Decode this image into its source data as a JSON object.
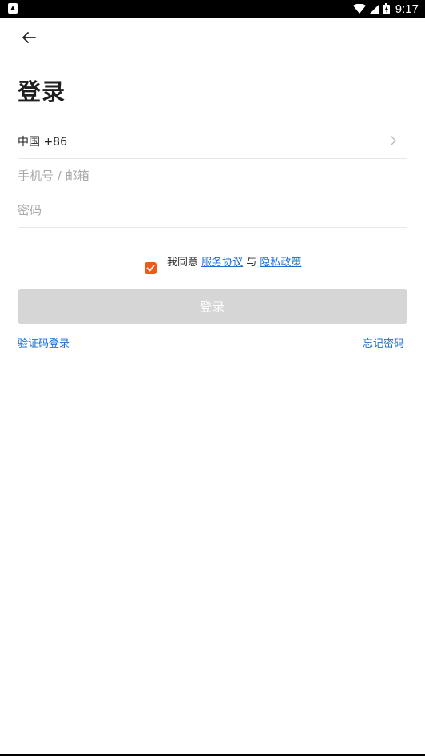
{
  "status_bar": {
    "time": "9:17",
    "icons": [
      "app-notification-icon",
      "wifi-icon",
      "signal-icon",
      "battery-icon"
    ]
  },
  "header": {
    "back_icon": "arrow-left-icon",
    "title": "登录"
  },
  "form": {
    "country": "中国 +86",
    "phone": {
      "value": "",
      "placeholder": "手机号 / 邮箱"
    },
    "password": {
      "value": "",
      "placeholder": "密码"
    }
  },
  "agreement": {
    "checked": true,
    "prefix": "我同意 ",
    "service_link": "服务协议",
    "connector": " 与 ",
    "privacy_link": "隐私政策"
  },
  "login_button": "登录",
  "links": {
    "code_login": "验证码登录",
    "forgot_password": "忘记密码"
  },
  "colors": {
    "accent": "#f05a18",
    "link": "#1a6fd6",
    "button_disabled": "#d6d6d6"
  }
}
